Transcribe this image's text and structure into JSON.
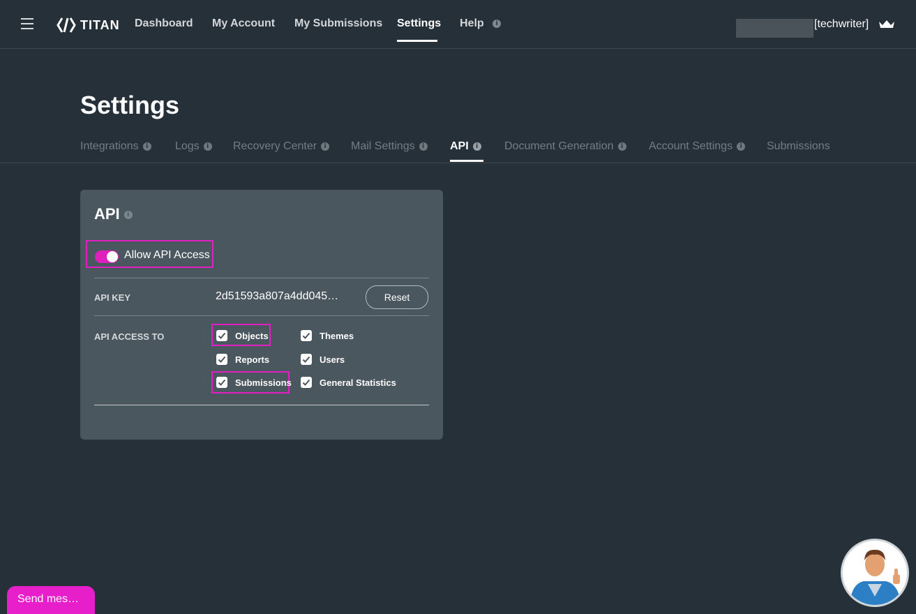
{
  "nav": {
    "brand": "TITAN",
    "items": [
      "Dashboard",
      "My Account",
      "My Submissions",
      "Settings",
      "Help"
    ],
    "active": "Settings",
    "info_glyph": "i",
    "user_label": "[techwriter]"
  },
  "page": {
    "title": "Settings",
    "tabs": [
      "Integrations",
      "Logs",
      "Recovery Center",
      "Mail Settings",
      "API",
      "Document Generation",
      "Account Settings",
      "Submissions"
    ],
    "active_tab": "API"
  },
  "api_card": {
    "title": "API",
    "toggle_label": "Allow API Access",
    "toggle_on": true,
    "api_key_label": "API KEY",
    "api_key_value": "2d51593a807a4dd045…",
    "reset_label": "Reset",
    "access_label": "API ACCESS TO",
    "options": [
      {
        "label": "Objects",
        "checked": true
      },
      {
        "label": "Themes",
        "checked": true
      },
      {
        "label": "Reports",
        "checked": true
      },
      {
        "label": "Users",
        "checked": true
      },
      {
        "label": "Submissions",
        "checked": true
      },
      {
        "label": "General Statistics",
        "checked": true
      }
    ]
  },
  "footer": {
    "send_message": "Send mes…"
  },
  "colors": {
    "accent": "#e61fcb",
    "background": "#263038",
    "card": "#4a575f"
  },
  "icons": [
    "menu-icon",
    "titan-logo-icon",
    "info-icon",
    "crown-icon",
    "checkmark-icon",
    "mascot-avatar"
  ]
}
